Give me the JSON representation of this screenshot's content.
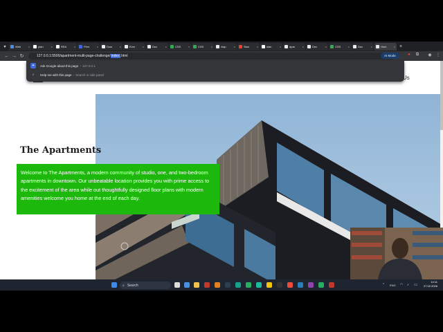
{
  "browser": {
    "tabs": [
      {
        "title": "Web",
        "color": "#4a90e2"
      },
      {
        "title": "plan",
        "color": "#ffffff"
      },
      {
        "title": "REA",
        "color": "#ffffff"
      },
      {
        "title": "Pers",
        "color": "#3d6ad8"
      },
      {
        "title": "Dow",
        "color": "#e8eaed"
      },
      {
        "title": "Ever",
        "color": "#e8eaed"
      },
      {
        "title": "Dec",
        "color": "#e8eaed"
      },
      {
        "title": "CSS",
        "color": "#34a853"
      },
      {
        "title": "CSS",
        "color": "#34a853"
      },
      {
        "title": "nlap",
        "color": "#e8eaed"
      },
      {
        "title": "Slan",
        "color": "#ea4335"
      },
      {
        "title": "slan",
        "color": "#ffffff"
      },
      {
        "title": "apar",
        "color": "#e8eaed"
      },
      {
        "title": "Dec",
        "color": "#e8eaed"
      },
      {
        "title": "CSS",
        "color": "#34a853"
      },
      {
        "title": "Dec",
        "color": "#e8eaed"
      },
      {
        "title": "Hom",
        "color": "#e8eaed"
      }
    ],
    "new_tab": "+",
    "url_prefix": "127.0.0.1:5500/apartment-multi-page-challenge/",
    "url_selected": "index",
    "url_suffix": ".html",
    "ai_mode": "AI Mode",
    "suggestions": [
      {
        "main": "Ask Google about this page",
        "sub": "– 127.0.0.1"
      },
      {
        "main": "Help me with this page",
        "sub": "– Search in side panel"
      }
    ]
  },
  "page": {
    "nav_partial": "Us",
    "title": "The Apartments",
    "intro": "Welcome to The Apartments, a modern community of studio, one, and two-bedroom apartments in downtown. Our unbeatable location provides you with prime access to the excitement of the area while out thoughtfully designed floor plans with modern amenities welcome you home at the end of each day."
  },
  "taskbar": {
    "search": "Search",
    "time": "14:11",
    "date": "27.02.2026",
    "lang": "ENG"
  },
  "colors": {
    "accent_green": "#1cb80c",
    "chrome_dark": "#202124"
  }
}
